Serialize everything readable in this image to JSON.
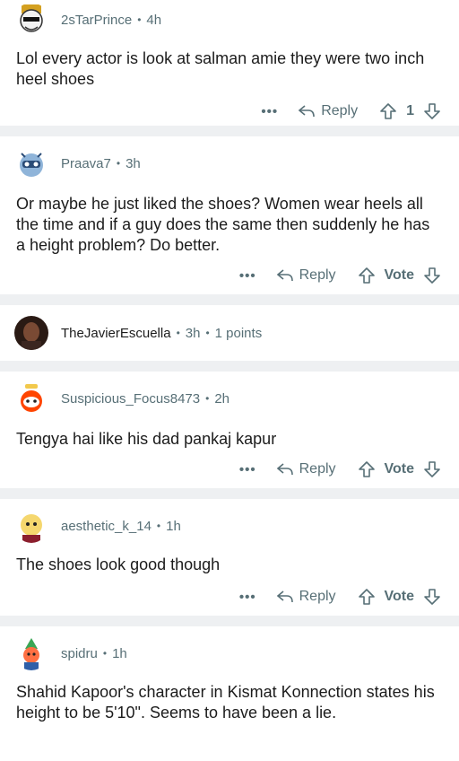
{
  "comments": [
    {
      "user": "2sTarPrince",
      "time": "4h",
      "points": "",
      "text": "Lol every actor is look at salman amie they were two inch heel shoes",
      "reply_label": "Reply",
      "vote": "1",
      "more": "•••"
    },
    {
      "user": "Praava7",
      "time": "3h",
      "points": "",
      "text": "Or maybe he just liked the shoes? Women wear heels all the time and if a guy does the same then suddenly he has a height problem? Do better.",
      "reply_label": "Reply",
      "vote": "Vote",
      "more": "•••"
    },
    {
      "user": "TheJavierEscuella",
      "time": "3h",
      "points": "1 points"
    },
    {
      "user": "Suspicious_Focus8473",
      "time": "2h",
      "points": "",
      "text": "Tengya hai like his dad pankaj kapur",
      "reply_label": "Reply",
      "vote": "Vote",
      "more": "•••"
    },
    {
      "user": "aesthetic_k_14",
      "time": "1h",
      "points": "",
      "text": "The shoes look good though",
      "reply_label": "Reply",
      "vote": "Vote",
      "more": "•••"
    },
    {
      "user": "spidru",
      "time": "1h",
      "points": "",
      "text": "Shahid Kapoor's character in Kismat Konnection states his height to be 5'10\". Seems to have been a lie."
    }
  ],
  "colors": {
    "meta": "#576f76",
    "separator": "#eef0f2",
    "text": "#1c1c1c"
  },
  "icons": {
    "reply": "reply-arrow-icon",
    "upvote": "upvote-arrow-icon",
    "downvote": "downvote-arrow-icon",
    "more": "more-dots-icon"
  }
}
